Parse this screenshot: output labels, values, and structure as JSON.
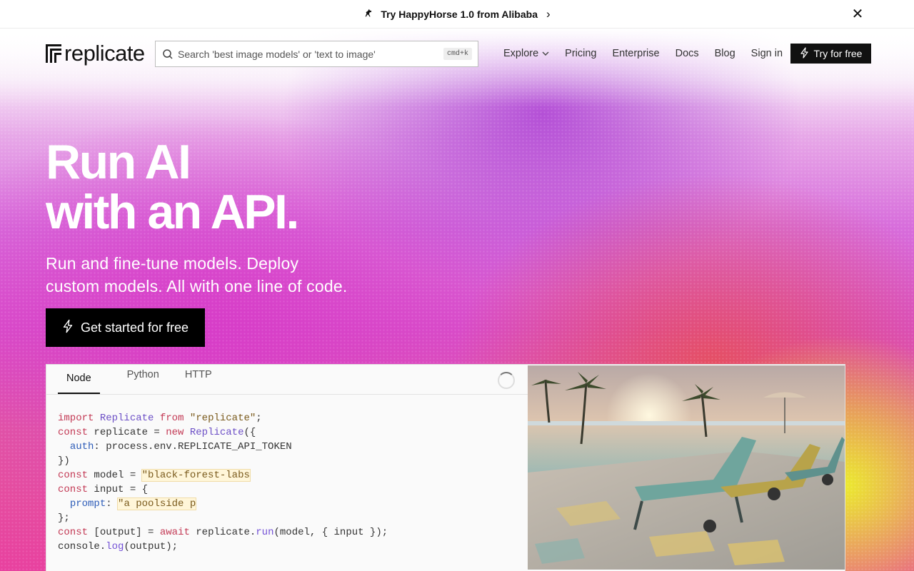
{
  "announcement": {
    "text": "Try HappyHorse 1.0 from Alibaba",
    "icon": "horse-icon"
  },
  "nav": {
    "logo_text": "replicate",
    "search_placeholder": "Search 'best image models' or 'text to image'",
    "search_shortcut": "cmd+k",
    "links": [
      {
        "label": "Explore",
        "has_dropdown": true
      },
      {
        "label": "Pricing"
      },
      {
        "label": "Enterprise"
      },
      {
        "label": "Docs"
      },
      {
        "label": "Blog"
      },
      {
        "label": "Sign in"
      }
    ],
    "cta_label": "Try for free"
  },
  "hero": {
    "title_line1": "Run AI",
    "title_line2": "with an API.",
    "subtitle_line1": "Run and fine-tune models. Deploy",
    "subtitle_line2": "custom models. All with one line of code.",
    "cta_label": "Get started for free"
  },
  "code_panel": {
    "tabs": [
      "Node",
      "Python",
      "HTTP"
    ],
    "active_tab": "Node",
    "lines": [
      "import Replicate from \"replicate\";",
      "const replicate = new Replicate({",
      "  auth: process.env.REPLICATE_API_TOKEN",
      "})",
      "const model = \"black-forest-labs",
      "const input = {",
      "  prompt: \"a poolside p",
      "};",
      "const [output] = await replicate.run(model, { input });",
      "console.log(output);"
    ]
  },
  "colors": {
    "accent_dark": "#111111",
    "keyword": "#c33a55",
    "class": "#6c4fc6",
    "property": "#2d5cb8"
  }
}
